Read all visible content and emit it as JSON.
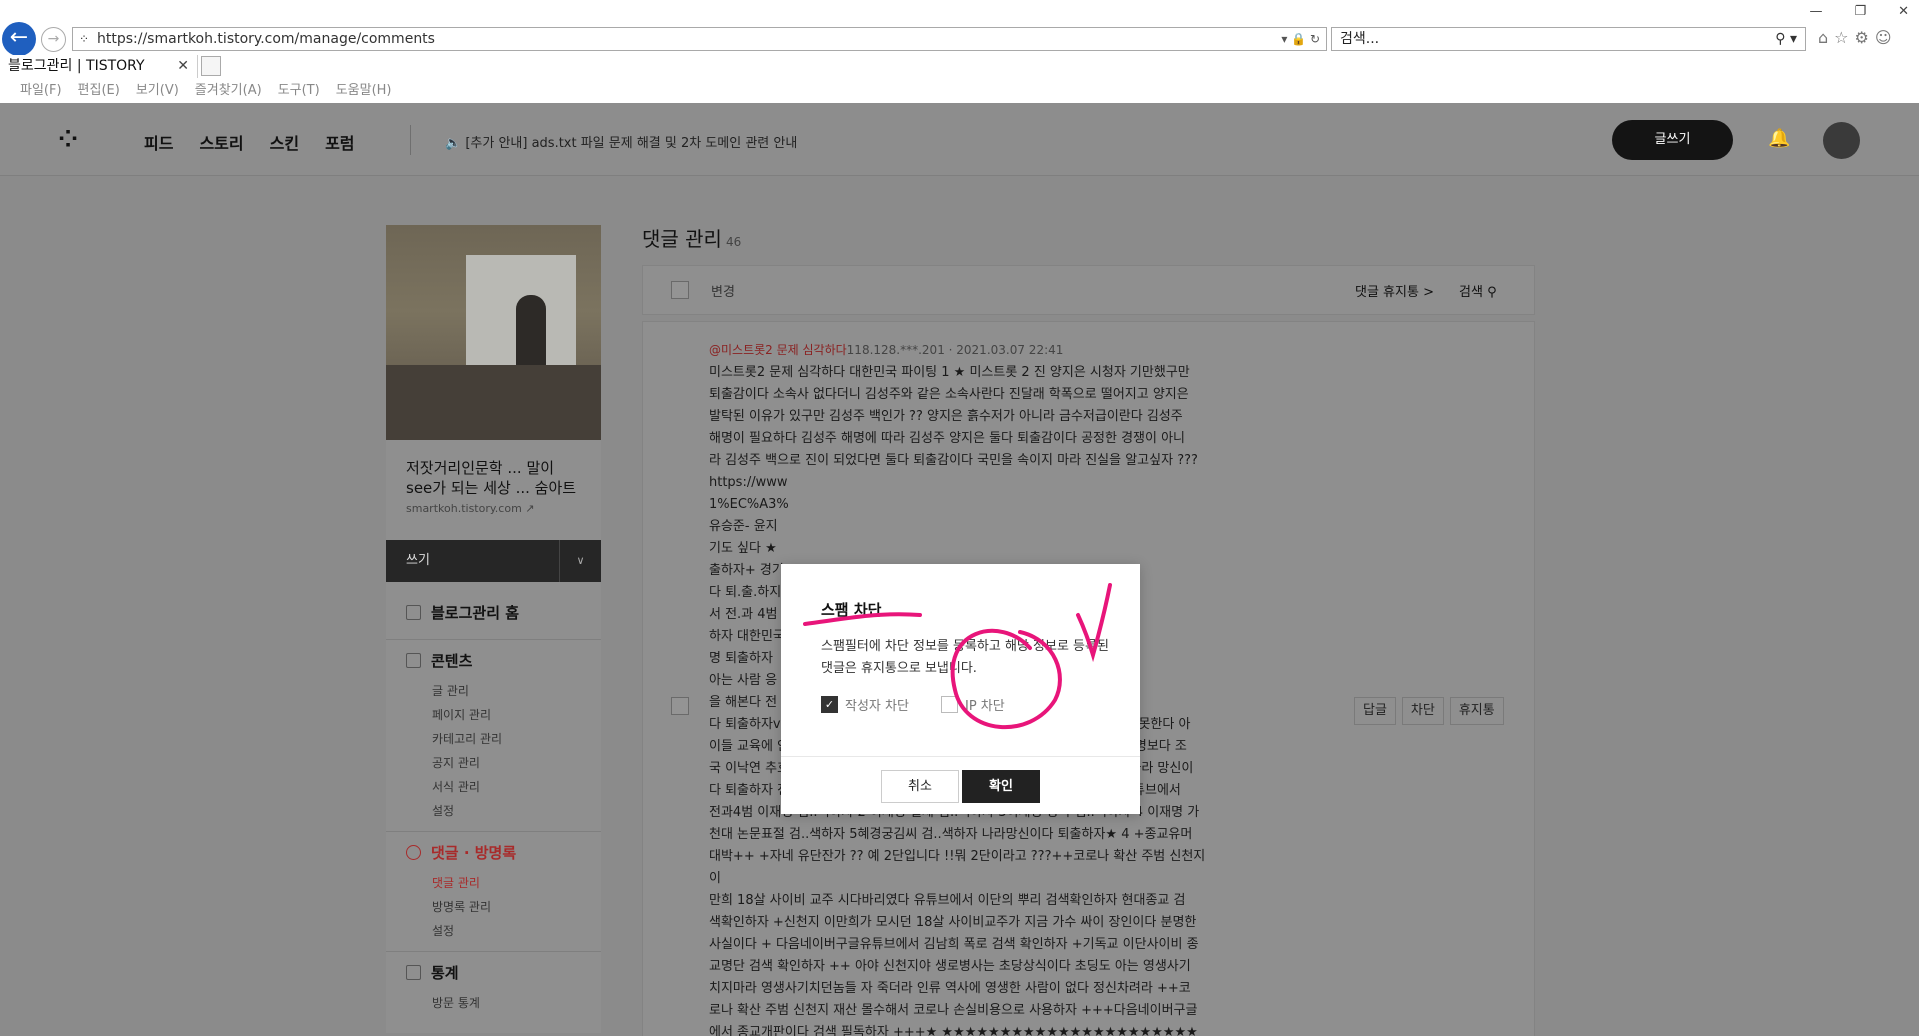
{
  "browser": {
    "url": "https://smartkoh.tistory.com/manage/comments",
    "search_placeholder": "검색...",
    "tab_title": "블로그관리 | TISTORY",
    "menu": [
      "파일(F)",
      "편집(E)",
      "보기(V)",
      "즐겨찾기(A)",
      "도구(T)",
      "도움말(H)"
    ]
  },
  "topnav": {
    "links": [
      "피드",
      "스토리",
      "스킨",
      "포럼"
    ],
    "notice": "[추가 안내] ads.txt 파일 문제 해결 및 2차 도메인 관련 안내",
    "write_label": "글쓰기"
  },
  "sidebar": {
    "blog_title_line1": "저잣거리인문학 ... 말이",
    "blog_title_line2": "see가 되는 세상 ... 숨아트",
    "blog_url": "smartkoh.tistory.com",
    "write_label": "쓰기",
    "home_label": "블로그관리 홈",
    "groups": [
      {
        "title": "콘텐츠",
        "items": [
          "글 관리",
          "페이지 관리",
          "카테고리 관리",
          "공지 관리",
          "서식 관리",
          "설정"
        ]
      },
      {
        "title": "댓글 · 방명록",
        "items": [
          "댓글 관리",
          "방명록 관리",
          "설정"
        ]
      },
      {
        "title": "통계",
        "items": [
          "방문 통계"
        ]
      }
    ]
  },
  "main": {
    "title": "댓글 관리",
    "count": "46",
    "toolbar": {
      "change_label": "변경",
      "trash_label": "댓글 휴지통 >",
      "search_label": "검색"
    },
    "comment": {
      "author": "@미스트롯2 문제 심각하다",
      "ip": "118.128.***.201",
      "date": "2021.03.07 22:41",
      "body_lines": [
        "미스트롯2 문제 심각하다 대한민국 파이팅 1 ★ 미스트롯 2 진 양지은 시청자 기만했구만",
        "퇴출감이다 소속사 없다더니 김성주와 같은 소속사란다 진달래 학폭으로 떨어지고 양지은",
        "발탁된 이유가 있구만 김성주 백인가 ?? 양지은 흙수저가 아니라 금수저급이란다 김성주",
        "해명이 필요하다 김성주 해명에 따라 김성주 양지은 둘다 퇴출감이다 공정한 경쟁이 아니",
        "라 김성주 백으로 진이 되었다면 둘다 퇴출감이다 국민을 속이지 마라 진실을 알고싶자 ???",
        "https://www",
        "1%EC%A3%",
        "유승준- 윤지",
        "기도 싶다 ★",
        "출하자+ 경기",
        "다 퇴.출.하지",
        "서 전.과 4범",
        "하자 대한민국",
        "명 퇴출하자",
        "아는 사람 응",
        "을 해본다 전",
        "다 퇴출하자v대한민국은 개나소나 대선후보하다 ??전과4범이면 편의점 알바도 못한다 아",
        "이들 교육에 안좋다 그만 정치해라 ??전과4범이고 총각사칭해 여배우먹은 이재명보다 조",
        "국 이낙연 추호영이 백번낫다 전과4범이 대선후보1위라고 여론 조작하지마라 나라 망신이",
        "다 퇴출하자 전과4범 초딩도 반대다 속지말자 나라망신이다..다음네이버구글유튜브에서",
        "전과4범 이재명 검..색하자 2 이재명 실체 검..색하자 3이재명 쌍욕 검..색하자 4 이재명 가",
        "천대 논문표절 검..색하자 5혜경궁김씨 검..색하자 나라망신이다 퇴출하자★ 4 +종교유머",
        "대박++ +자네 유단잔가 ?? 예 2단입니다 !!뭐 2단이라고 ???++코로나 확산 주범 신천지 이",
        "만희 18살 사이비 교주 시다바리였다 유튜브에서 이단의 뿌리 검색확인하자 현대종교 검",
        "색확인하자 +신천지 이만희가 모시던 18살 사이비교주가 지금 가수 싸이 장인이다 분명한",
        "사실이다 + 다음네이버구글유튜브에서 김남희 폭로 검색 확인하자 +기독교 이단사이비 종",
        "교명단 검색 확인하자 ++ 아야 신천지야 생로병사는 초당상식이다 초딩도 아는 영생사기",
        "치지마라 영생사기치던놈들 자 죽더라 인류 역사에 영생한 사람이 없다 정신차려라 ++코",
        "로나 확산 주범 신천지 재산 몰수해서 코로나 손실비용으로 사용하자 +++다음네이버구글",
        "에서 종교개판이다 검색 필독하자 +++★ ★★★★★★★★★★★★★★★★★★★★★★",
        "★★★★★★★★★★★★★★★★★★★★"
      ],
      "actions": [
        "답글",
        "차단",
        "휴지통"
      ]
    }
  },
  "modal": {
    "title": "스팸 차단",
    "desc": "스팸필터에 차단 정보를 등록하고 해당 정보로 등록된 댓글은 휴지통으로 보냅니다.",
    "opt_author": "작성자 차단",
    "opt_ip": "IP 차단",
    "cancel": "취소",
    "ok": "확인"
  },
  "colors": {
    "annotation": "#e8157a",
    "overlay": "#8b8b8b"
  }
}
